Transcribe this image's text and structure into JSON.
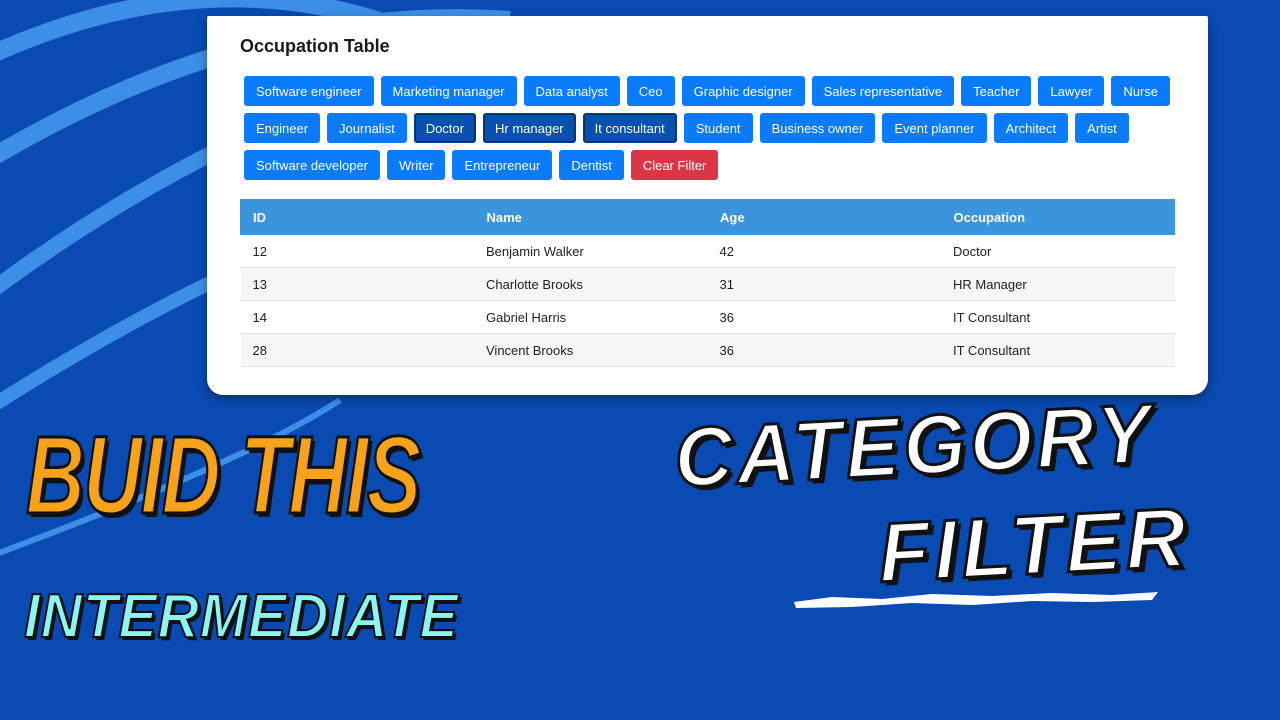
{
  "card": {
    "title": "Occupation Table"
  },
  "filters": {
    "row1": [
      "Software engineer",
      "Marketing manager",
      "Data analyst",
      "Ceo",
      "Graphic designer",
      "Sales representative",
      "Teacher",
      "Lawyer",
      "Nurse"
    ],
    "row2": [
      "Engineer",
      "Journalist",
      "Doctor",
      "Hr manager",
      "It consultant",
      "Student",
      "Business owner",
      "Event planner",
      "Architect",
      "Artist"
    ],
    "row3": [
      "Software developer",
      "Writer",
      "Entrepreneur",
      "Dentist"
    ],
    "active": [
      "Doctor",
      "Hr manager",
      "It consultant"
    ],
    "clear_label": "Clear Filter"
  },
  "table": {
    "headers": [
      "ID",
      "Name",
      "Age",
      "Occupation"
    ],
    "rows": [
      [
        "12",
        "Benjamin Walker",
        "42",
        "Doctor"
      ],
      [
        "13",
        "Charlotte Brooks",
        "31",
        "HR Manager"
      ],
      [
        "14",
        "Gabriel Harris",
        "36",
        "IT Consultant"
      ],
      [
        "28",
        "Vincent Brooks",
        "36",
        "IT Consultant"
      ]
    ]
  },
  "overlay": {
    "line1": "BUID THIS",
    "line2": "INTERMEDIATE",
    "title1": "CATEGORY",
    "title2": "FILTER"
  },
  "colors": {
    "background": "#0a4ab3",
    "button": "#0a7bfb",
    "button_active": "#0650b0",
    "button_clear": "#dc3545",
    "table_header": "#3a95dd",
    "headline_orange": "#f7a21b",
    "headline_cyan": "#8cf5ef"
  }
}
